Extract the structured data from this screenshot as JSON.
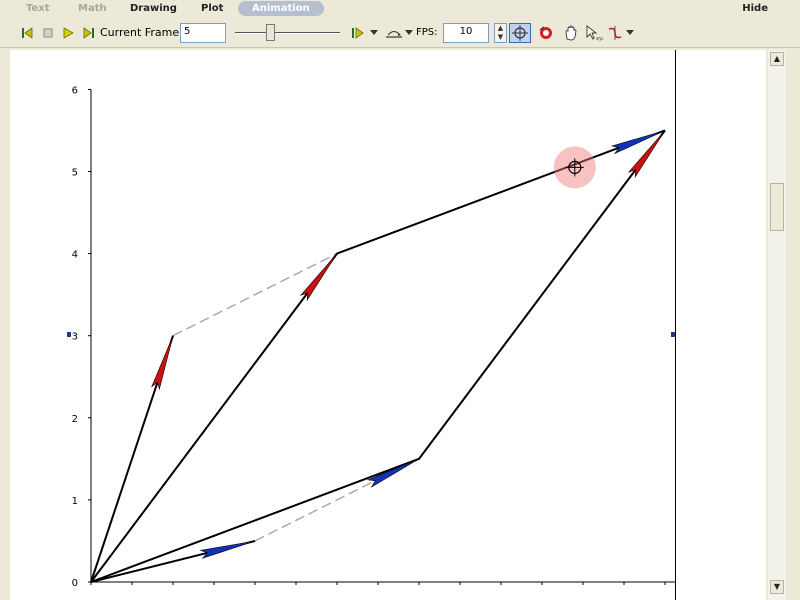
{
  "menu": {
    "tabs": [
      {
        "label": "Text",
        "state": "disabled"
      },
      {
        "label": "Math",
        "state": "disabled"
      },
      {
        "label": "Drawing",
        "state": "normal"
      },
      {
        "label": "Plot",
        "state": "normal"
      },
      {
        "label": "Animation",
        "state": "active"
      }
    ],
    "hide_label": "Hide"
  },
  "toolbar": {
    "current_frame_label": "Current Frame",
    "current_frame_value": "5",
    "fps_label": "FPS:",
    "fps_value": "10",
    "slider_position": 0.35
  },
  "icons": {
    "first_frame": "go-to-first-frame-icon",
    "stop": "stop-icon",
    "play": "play-icon",
    "step": "step-forward-icon",
    "play_options": "play-options-icon",
    "playback_mode": "playback-mode-icon",
    "point_probe": "point-probe-icon",
    "rotate": "rotate-icon",
    "pan": "pan-icon",
    "scale": "scale-icon",
    "transform": "transform-icon"
  },
  "chart_data": {
    "type": "line",
    "y_ticks": [
      "0",
      "1",
      "2",
      "3",
      "4",
      "5",
      "6"
    ],
    "ylim": [
      0,
      6
    ],
    "xlim": [
      0,
      7
    ],
    "colors": {
      "red_arrow": "#cc1111",
      "blue_arrow": "#1133bb",
      "line": "#000000",
      "dashed": "#aaaaaa"
    },
    "solid_lines": [
      {
        "points": [
          [
            0,
            0
          ],
          [
            3,
            4
          ],
          [
            7,
            5.5
          ]
        ]
      },
      {
        "points": [
          [
            0,
            0
          ],
          [
            4,
            1.5
          ],
          [
            7,
            5.5
          ]
        ]
      },
      {
        "points": [
          [
            0,
            0
          ],
          [
            1,
            3
          ]
        ]
      },
      {
        "points": [
          [
            0,
            0
          ],
          [
            2,
            0.5
          ]
        ]
      }
    ],
    "dashed_lines": [
      {
        "points": [
          [
            1,
            3
          ],
          [
            3,
            4
          ]
        ]
      },
      {
        "points": [
          [
            2,
            0.5
          ],
          [
            4,
            1.5
          ]
        ]
      }
    ],
    "red_arrows": [
      {
        "from": [
          0,
          0
        ],
        "to": [
          1,
          3
        ]
      },
      {
        "from": [
          0,
          0
        ],
        "to": [
          3,
          4
        ]
      },
      {
        "from": [
          4,
          1.5
        ],
        "to": [
          7,
          5.5
        ]
      }
    ],
    "blue_arrows": [
      {
        "from": [
          0,
          0
        ],
        "to": [
          2,
          0.5
        ]
      },
      {
        "from": [
          2,
          0.5
        ],
        "to": [
          4,
          1.5
        ]
      },
      {
        "from": [
          3,
          4
        ],
        "to": [
          7,
          5.5
        ]
      }
    ],
    "cursor_point": [
      5.9,
      5.05
    ]
  }
}
